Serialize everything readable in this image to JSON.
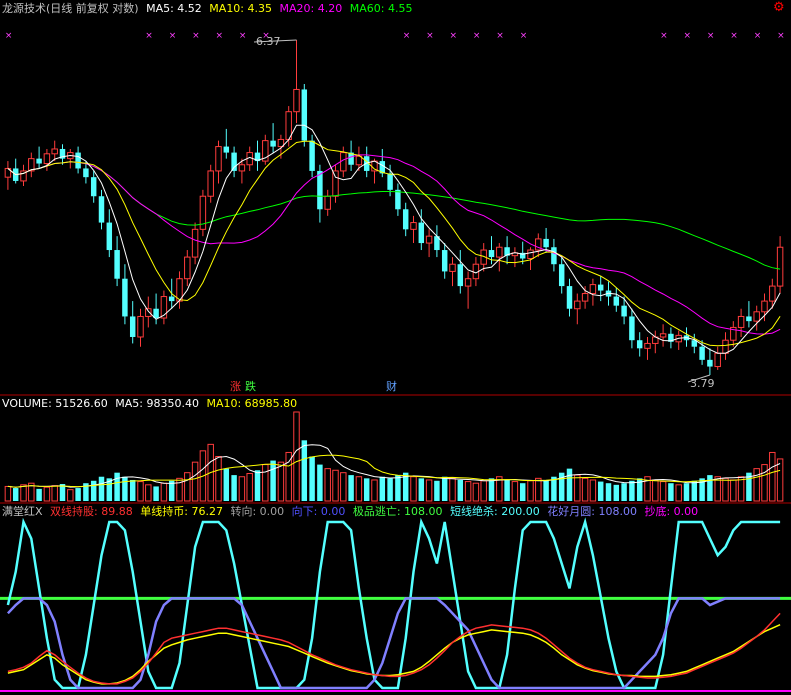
{
  "price_panel": {
    "title": "龙源技术(日线 前复权 对数)",
    "ma_labels": [
      {
        "text": "MA5: 4.52",
        "color": "#ffffff"
      },
      {
        "text": "MA10: 4.35",
        "color": "#ffff00"
      },
      {
        "text": "MA20: 4.20",
        "color": "#ff00ff"
      },
      {
        "text": "MA60: 4.55",
        "color": "#00ff00"
      }
    ],
    "high_label": "6.37",
    "low_label": "3.79",
    "event_markers": [
      {
        "text": "涨",
        "color": "#ff3030"
      },
      {
        "text": "跌",
        "color": "#40ff40"
      },
      {
        "text": "财",
        "color": "#60a0ff"
      }
    ],
    "corner_icon": "gear-icon",
    "up_color": "#ff3c3c",
    "down_color": "#54ffff"
  },
  "volume_panel": {
    "labels": [
      {
        "text": "VOLUME: 51526.60",
        "color": "#ffffff"
      },
      {
        "text": "MA5: 98350.40",
        "color": "#ffffff"
      },
      {
        "text": "MA10: 68985.80",
        "color": "#ffff00"
      }
    ]
  },
  "indicator_panel": {
    "labels": [
      {
        "text": "满堂红X",
        "color": "#c0c0c0"
      },
      {
        "text": "双线持股: 89.88",
        "color": "#ff3030"
      },
      {
        "text": "单线持币: 76.27",
        "color": "#ffff00"
      },
      {
        "text": "转向: 0.00",
        "color": "#a0a0a0"
      },
      {
        "text": "向下: 0.00",
        "color": "#5050ff"
      },
      {
        "text": "极品逃亡: 108.00",
        "color": "#40ff40"
      },
      {
        "text": "短线绝杀: 200.00",
        "color": "#54ffff"
      },
      {
        "text": "花好月圆: 108.00",
        "color": "#8080ff"
      },
      {
        "text": "抄底: 0.00",
        "color": "#ff00ff"
      }
    ]
  },
  "chart_data": {
    "type": "candlestick",
    "price_range": [
      3.79,
      6.37
    ],
    "ohlc": [
      [
        5.15,
        5.28,
        5.05,
        5.22
      ],
      [
        5.22,
        5.3,
        5.1,
        5.12
      ],
      [
        5.12,
        5.25,
        5.08,
        5.2
      ],
      [
        5.2,
        5.35,
        5.15,
        5.3
      ],
      [
        5.3,
        5.4,
        5.22,
        5.26
      ],
      [
        5.26,
        5.38,
        5.2,
        5.34
      ],
      [
        5.34,
        5.45,
        5.28,
        5.38
      ],
      [
        5.38,
        5.42,
        5.25,
        5.3
      ],
      [
        5.3,
        5.38,
        5.22,
        5.35
      ],
      [
        5.35,
        5.4,
        5.18,
        5.22
      ],
      [
        5.22,
        5.28,
        5.1,
        5.15
      ],
      [
        5.15,
        5.2,
        4.95,
        5.0
      ],
      [
        5.0,
        5.05,
        4.75,
        4.8
      ],
      [
        4.8,
        4.9,
        4.55,
        4.6
      ],
      [
        4.6,
        4.7,
        4.35,
        4.4
      ],
      [
        4.4,
        4.5,
        4.1,
        4.15
      ],
      [
        4.15,
        4.25,
        3.98,
        4.02
      ],
      [
        4.02,
        4.2,
        3.96,
        4.15
      ],
      [
        4.15,
        4.28,
        4.08,
        4.2
      ],
      [
        4.2,
        4.3,
        4.1,
        4.14
      ],
      [
        4.14,
        4.32,
        4.1,
        4.28
      ],
      [
        4.28,
        4.4,
        4.2,
        4.25
      ],
      [
        4.25,
        4.45,
        4.2,
        4.4
      ],
      [
        4.4,
        4.6,
        4.35,
        4.55
      ],
      [
        4.55,
        4.8,
        4.5,
        4.75
      ],
      [
        4.75,
        5.05,
        4.7,
        5.0
      ],
      [
        5.0,
        5.25,
        4.95,
        5.2
      ],
      [
        5.2,
        5.45,
        5.1,
        5.4
      ],
      [
        5.4,
        5.55,
        5.3,
        5.35
      ],
      [
        5.35,
        5.4,
        5.15,
        5.2
      ],
      [
        5.2,
        5.3,
        5.1,
        5.25
      ],
      [
        5.25,
        5.4,
        5.2,
        5.35
      ],
      [
        5.35,
        5.45,
        5.2,
        5.28
      ],
      [
        5.28,
        5.5,
        5.25,
        5.45
      ],
      [
        5.45,
        5.6,
        5.35,
        5.4
      ],
      [
        5.4,
        5.5,
        5.3,
        5.46
      ],
      [
        5.46,
        5.75,
        5.4,
        5.7
      ],
      [
        5.7,
        6.37,
        5.6,
        5.9
      ],
      [
        5.9,
        5.95,
        5.4,
        5.45
      ],
      [
        5.45,
        5.5,
        5.15,
        5.2
      ],
      [
        5.2,
        5.25,
        4.8,
        4.9
      ],
      [
        4.9,
        5.05,
        4.85,
        5.0
      ],
      [
        5.0,
        5.25,
        4.95,
        5.2
      ],
      [
        5.2,
        5.4,
        5.15,
        5.35
      ],
      [
        5.35,
        5.45,
        5.2,
        5.25
      ],
      [
        5.25,
        5.4,
        5.2,
        5.32
      ],
      [
        5.32,
        5.4,
        5.15,
        5.2
      ],
      [
        5.2,
        5.3,
        5.1,
        5.28
      ],
      [
        5.28,
        5.38,
        5.15,
        5.18
      ],
      [
        5.18,
        5.25,
        5.0,
        5.05
      ],
      [
        5.05,
        5.1,
        4.85,
        4.9
      ],
      [
        4.9,
        4.95,
        4.7,
        4.75
      ],
      [
        4.75,
        4.85,
        4.65,
        4.8
      ],
      [
        4.8,
        4.9,
        4.6,
        4.65
      ],
      [
        4.65,
        4.75,
        4.55,
        4.7
      ],
      [
        4.7,
        4.78,
        4.55,
        4.6
      ],
      [
        4.6,
        4.65,
        4.4,
        4.45
      ],
      [
        4.45,
        4.55,
        4.35,
        4.5
      ],
      [
        4.5,
        4.6,
        4.3,
        4.35
      ],
      [
        4.35,
        4.45,
        4.2,
        4.4
      ],
      [
        4.4,
        4.55,
        4.35,
        4.5
      ],
      [
        4.5,
        4.65,
        4.45,
        4.6
      ],
      [
        4.6,
        4.7,
        4.5,
        4.55
      ],
      [
        4.55,
        4.65,
        4.45,
        4.62
      ],
      [
        4.62,
        4.7,
        4.5,
        4.56
      ],
      [
        4.56,
        4.62,
        4.48,
        4.58
      ],
      [
        4.58,
        4.66,
        4.5,
        4.54
      ],
      [
        4.54,
        4.62,
        4.46,
        4.6
      ],
      [
        4.6,
        4.72,
        4.55,
        4.68
      ],
      [
        4.68,
        4.76,
        4.58,
        4.62
      ],
      [
        4.62,
        4.68,
        4.45,
        4.5
      ],
      [
        4.5,
        4.55,
        4.3,
        4.35
      ],
      [
        4.35,
        4.4,
        4.15,
        4.2
      ],
      [
        4.2,
        4.3,
        4.1,
        4.25
      ],
      [
        4.25,
        4.35,
        4.2,
        4.3
      ],
      [
        4.3,
        4.4,
        4.22,
        4.36
      ],
      [
        4.36,
        4.42,
        4.25,
        4.32
      ],
      [
        4.32,
        4.38,
        4.22,
        4.28
      ],
      [
        4.28,
        4.34,
        4.18,
        4.22
      ],
      [
        4.22,
        4.28,
        4.1,
        4.15
      ],
      [
        4.15,
        4.2,
        3.95,
        4.0
      ],
      [
        4.0,
        4.05,
        3.9,
        3.95
      ],
      [
        3.95,
        4.02,
        3.88,
        3.98
      ],
      [
        3.98,
        4.06,
        3.92,
        4.02
      ],
      [
        4.02,
        4.1,
        3.96,
        4.04
      ],
      [
        4.04,
        4.08,
        3.95,
        3.99
      ],
      [
        3.99,
        4.06,
        3.94,
        4.03
      ],
      [
        4.03,
        4.08,
        3.96,
        4.0
      ],
      [
        4.0,
        4.04,
        3.92,
        3.96
      ],
      [
        3.96,
        4.0,
        3.85,
        3.88
      ],
      [
        3.88,
        3.95,
        3.79,
        3.84
      ],
      [
        3.84,
        3.96,
        3.82,
        3.92
      ],
      [
        3.92,
        4.05,
        3.88,
        4.0
      ],
      [
        4.0,
        4.12,
        3.96,
        4.08
      ],
      [
        4.08,
        4.2,
        4.02,
        4.15
      ],
      [
        4.15,
        4.25,
        4.08,
        4.12
      ],
      [
        4.12,
        4.22,
        4.06,
        4.18
      ],
      [
        4.18,
        4.3,
        4.12,
        4.25
      ],
      [
        4.25,
        4.4,
        4.2,
        4.35
      ],
      [
        4.35,
        4.7,
        4.3,
        4.62
      ]
    ],
    "volume": [
      18,
      16,
      20,
      22,
      15,
      17,
      19,
      21,
      14,
      16,
      22,
      25,
      30,
      28,
      35,
      30,
      26,
      24,
      20,
      18,
      22,
      25,
      28,
      35,
      48,
      62,
      70,
      55,
      40,
      32,
      30,
      34,
      38,
      45,
      50,
      48,
      60,
      110,
      75,
      55,
      45,
      40,
      38,
      35,
      32,
      30,
      28,
      26,
      30,
      28,
      32,
      35,
      30,
      28,
      26,
      25,
      30,
      28,
      26,
      24,
      22,
      25,
      28,
      30,
      26,
      24,
      22,
      25,
      28,
      26,
      30,
      35,
      40,
      32,
      28,
      26,
      24,
      22,
      20,
      22,
      25,
      28,
      30,
      26,
      24,
      22,
      20,
      22,
      25,
      28,
      32,
      30,
      28,
      26,
      30,
      35,
      40,
      45,
      60,
      52
    ],
    "volume_ma": {
      "MA5": 98350.4,
      "MA10": 68985.8,
      "VOLUME": 51526.6
    },
    "ma": {
      "MA5": 4.52,
      "MA10": 4.35,
      "MA20": 4.2,
      "MA60": 4.55
    },
    "indicator": {
      "range": [
        0,
        200
      ],
      "series": [
        {
          "name": "双线持股",
          "color": "#ff3030",
          "values": [
            20,
            22,
            25,
            30,
            38,
            45,
            40,
            32,
            25,
            18,
            12,
            8,
            6,
            5,
            5,
            8,
            12,
            20,
            30,
            42,
            55,
            60,
            62,
            64,
            66,
            68,
            70,
            72,
            72,
            70,
            68,
            66,
            64,
            62,
            60,
            58,
            55,
            50,
            45,
            40,
            36,
            32,
            28,
            25,
            22,
            20,
            18,
            16,
            15,
            14,
            14,
            15,
            18,
            22,
            28,
            36,
            45,
            55,
            62,
            68,
            72,
            74,
            76,
            75,
            74,
            73,
            72,
            70,
            66,
            60,
            52,
            44,
            36,
            30,
            25,
            22,
            20,
            18,
            16,
            15,
            14,
            13,
            12,
            12,
            13,
            14,
            16,
            18,
            22,
            26,
            30,
            34,
            38,
            42,
            48,
            55,
            62,
            70,
            80,
            89.88
          ]
        },
        {
          "name": "单线持币",
          "color": "#ffff00",
          "values": [
            18,
            20,
            22,
            28,
            34,
            40,
            36,
            28,
            22,
            16,
            10,
            7,
            5,
            5,
            6,
            9,
            14,
            22,
            32,
            40,
            48,
            52,
            55,
            58,
            60,
            62,
            64,
            66,
            66,
            64,
            62,
            60,
            58,
            56,
            54,
            52,
            50,
            46,
            42,
            38,
            34,
            30,
            27,
            24,
            21,
            19,
            17,
            16,
            15,
            15,
            16,
            18,
            20,
            25,
            32,
            40,
            48,
            55,
            60,
            64,
            66,
            68,
            70,
            69,
            68,
            67,
            66,
            64,
            60,
            55,
            48,
            40,
            34,
            28,
            24,
            21,
            19,
            17,
            16,
            15,
            15,
            14,
            14,
            14,
            15,
            16,
            18,
            20,
            24,
            28,
            32,
            36,
            40,
            44,
            50,
            56,
            62,
            68,
            72,
            76.27
          ]
        },
        {
          "name": "短线绝杀",
          "color": "#54ffff",
          "values": [
            100,
            140,
            200,
            180,
            120,
            60,
            10,
            0,
            0,
            0,
            40,
            100,
            160,
            200,
            200,
            190,
            140,
            80,
            20,
            0,
            0,
            0,
            30,
            100,
            170,
            200,
            200,
            200,
            190,
            150,
            100,
            50,
            0,
            0,
            0,
            0,
            0,
            0,
            10,
            60,
            140,
            200,
            200,
            200,
            190,
            120,
            60,
            10,
            0,
            0,
            0,
            60,
            140,
            200,
            180,
            150,
            200,
            140,
            80,
            20,
            0,
            0,
            0,
            0,
            40,
            120,
            190,
            200,
            200,
            200,
            180,
            150,
            120,
            170,
            200,
            160,
            110,
            60,
            20,
            0,
            0,
            0,
            0,
            0,
            40,
            120,
            200,
            200,
            200,
            200,
            180,
            160,
            170,
            190,
            200,
            200,
            200,
            200,
            200,
            200
          ]
        },
        {
          "name": "花好月圆",
          "color": "#8080ff",
          "values": [
            90,
            100,
            108,
            108,
            108,
            100,
            80,
            40,
            10,
            0,
            0,
            0,
            0,
            0,
            0,
            0,
            0,
            10,
            40,
            80,
            100,
            108,
            108,
            108,
            108,
            108,
            108,
            108,
            108,
            108,
            100,
            80,
            60,
            40,
            20,
            0,
            0,
            0,
            0,
            0,
            0,
            0,
            0,
            0,
            0,
            0,
            0,
            10,
            30,
            60,
            90,
            108,
            108,
            108,
            108,
            108,
            100,
            90,
            80,
            70,
            50,
            30,
            10,
            0,
            0,
            0,
            0,
            0,
            0,
            0,
            0,
            0,
            0,
            0,
            0,
            0,
            0,
            0,
            0,
            0,
            10,
            20,
            30,
            40,
            60,
            90,
            108,
            108,
            108,
            108,
            100,
            104,
            108,
            108,
            108,
            108,
            108,
            108,
            108,
            108
          ]
        }
      ],
      "level_lines": [
        108,
        0
      ]
    }
  }
}
